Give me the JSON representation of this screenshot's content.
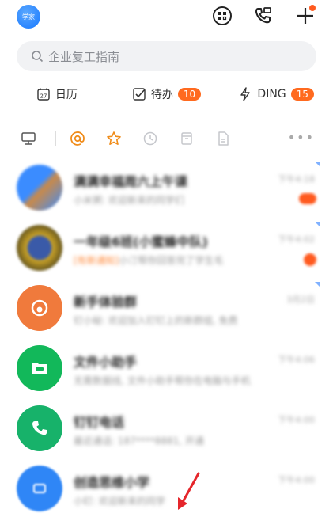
{
  "top": {
    "avatar_text": "学家"
  },
  "search": {
    "placeholder": "企业复工指南"
  },
  "quick": [
    {
      "label": "日历"
    },
    {
      "label": "待办",
      "badge": "10"
    },
    {
      "label": "DING",
      "badge": "15"
    }
  ],
  "chats": [
    {
      "title": "满满幸福周六上午课",
      "tag": "",
      "sub": "小米粥: 欢迎新来的同学们",
      "time": "下午4:18"
    },
    {
      "title": "一年级6班(小蜜蜂中队)",
      "tag": "",
      "sub_highlight": "[有新通知]",
      "sub": "小汀帮你回答完了学生毛",
      "time": "下午4:02"
    },
    {
      "title": "新手体验群",
      "tag": "",
      "sub": "钉小秘: 欢迎加入钉钉上的新群组, 免费",
      "time": "3月2日"
    },
    {
      "title": "文件小助手",
      "tag": "",
      "sub": "无需数据线, 文件小助手帮你在电脑与手机",
      "time": "下午4:06"
    },
    {
      "title": "钉钉电话",
      "tag": "",
      "sub": "最近通话: 187****8881, 开通",
      "time": "下午4:00"
    },
    {
      "title": "创造思维小学",
      "tag": "",
      "sub": "小钉: 欢迎新来的同学",
      "time": "下午4:00"
    }
  ],
  "colors": {
    "accent": "#1677ff",
    "badge": "#ff6a1f",
    "star": "#f08c1a"
  }
}
